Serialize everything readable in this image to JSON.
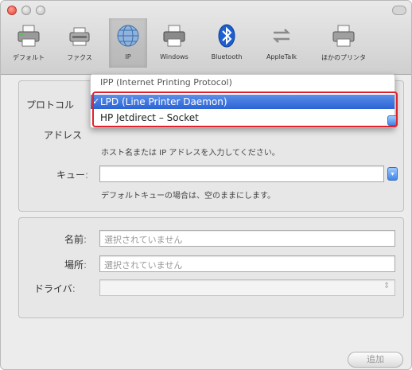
{
  "toolbar": {
    "items": [
      {
        "label": "デフォルト",
        "icon": "printer-default-icon"
      },
      {
        "label": "ファクス",
        "icon": "fax-icon"
      },
      {
        "label": "IP",
        "icon": "ip-globe-icon",
        "selected": true
      },
      {
        "label": "Windows",
        "icon": "windows-printer-icon"
      },
      {
        "label": "Bluetooth",
        "icon": "bluetooth-icon"
      },
      {
        "label": "AppleTalk",
        "icon": "appletalk-icon"
      },
      {
        "label": "ほかのプリンタ",
        "icon": "other-printer-icon"
      }
    ]
  },
  "form": {
    "protocol_label": "プロトコル",
    "address_label": "アドレス",
    "address_hint": "ホスト名または IP アドレスを入力してください。",
    "queue_label": "キュー",
    "queue_hint": "デフォルトキューの場合は、空のままにします。",
    "colon": ":"
  },
  "protocol_menu": {
    "options": [
      {
        "label": "IPP (Internet Printing Protocol)",
        "checked": false
      },
      {
        "label": "LPD (Line Printer Daemon)",
        "checked": true
      },
      {
        "label": "HP Jetdirect – Socket",
        "checked": false
      }
    ],
    "check_mark": "✓"
  },
  "details": {
    "name_label": "名前",
    "name_value": "選択されていません",
    "location_label": "場所",
    "location_value": "選択されていません",
    "driver_label": "ドライバ",
    "driver_value": ""
  },
  "footer": {
    "add_label": "追加"
  },
  "colors": {
    "accent": "#2a63d6",
    "highlight": "#e0232a"
  }
}
